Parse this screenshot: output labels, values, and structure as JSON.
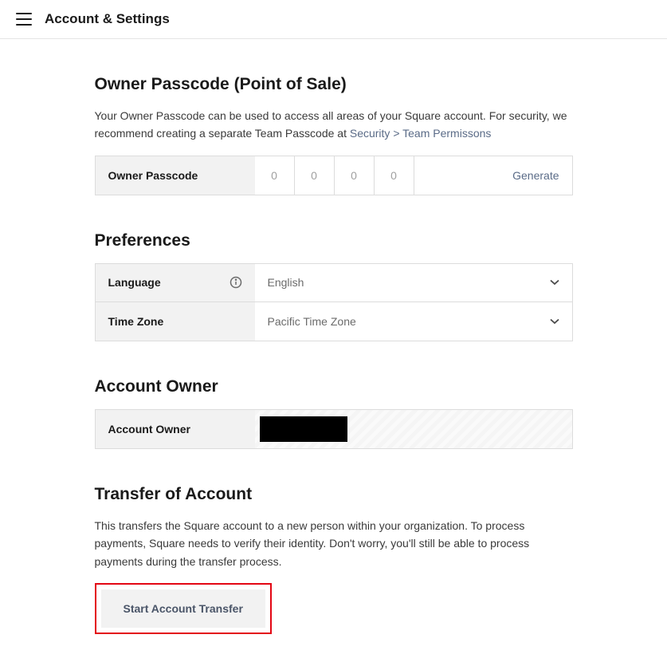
{
  "header": {
    "title": "Account & Settings"
  },
  "passcode": {
    "title": "Owner Passcode (Point of Sale)",
    "description": "Your Owner Passcode can be used to access all areas of your Square account. For security, we recommend creating a separate Team Passcode at ",
    "link_text": "Security > Team Permissons",
    "label": "Owner Passcode",
    "digits": [
      "0",
      "0",
      "0",
      "0"
    ],
    "generate_label": "Generate"
  },
  "preferences": {
    "title": "Preferences",
    "language_label": "Language",
    "language_value": "English",
    "timezone_label": "Time Zone",
    "timezone_value": "Pacific Time Zone"
  },
  "owner": {
    "title": "Account Owner",
    "label": "Account Owner"
  },
  "transfer": {
    "title": "Transfer of Account",
    "description": "This transfers the Square account to a new person within your organization. To process payments, Square needs to verify their identity. Don't worry, you'll still be able to process payments during the transfer process.",
    "button_label": "Start Account Transfer"
  }
}
